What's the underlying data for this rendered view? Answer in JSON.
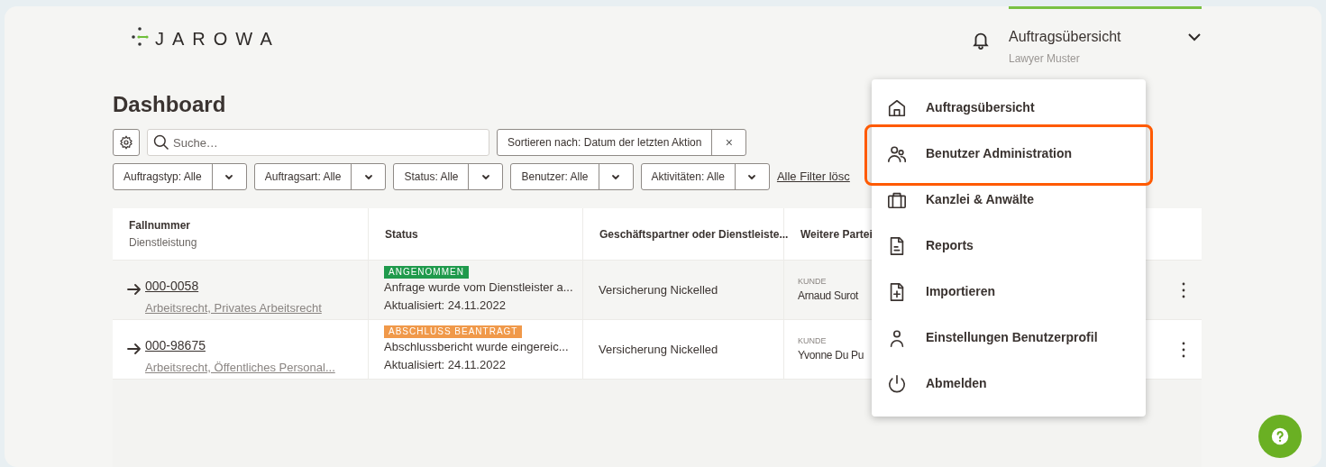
{
  "logo": {
    "text": "JAROWA"
  },
  "header": {
    "nav_label": "Auftragsübersicht",
    "user": "Lawyer Muster"
  },
  "title": "Dashboard",
  "search": {
    "placeholder": "Suche…"
  },
  "sort": {
    "label": "Sortieren nach: Datum der letzten Aktion",
    "clear": "×"
  },
  "filters": [
    {
      "label": "Auftragstyp: Alle"
    },
    {
      "label": "Auftragsart: Alle"
    },
    {
      "label": "Status: Alle"
    },
    {
      "label": "Benutzer: Alle"
    },
    {
      "label": "Aktivitäten: Alle"
    }
  ],
  "clear_filters": "Alle Filter lösc",
  "table": {
    "columns": [
      {
        "title": "Fallnummer",
        "subtitle": "Dienstleistung"
      },
      {
        "title": "Status"
      },
      {
        "title": "Geschäftspartner oder Dienstleiste..."
      },
      {
        "title": "Weitere Partei"
      }
    ],
    "rows": [
      {
        "highlighted": true,
        "case_number": "000-0058",
        "service": "Arbeitsrecht, Privates Arbeitsrecht",
        "status_badge": "ANGENOMMEN",
        "color": "#1f9a4c",
        "status_text": "Anfrage wurde vom Dienstleister a...",
        "updated": "Aktualisiert: 24.11.2022",
        "partner": "Versicherung Nickelled",
        "party_role": "KUNDE",
        "party_name": "Arnaud Surot"
      },
      {
        "highlighted": false,
        "case_number": "000-98675",
        "service": "Arbeitsrecht, Öffentliches Personal...",
        "status_badge": "ABSCHLUSS BEANTRAGT",
        "color": "#f0994a",
        "status_text": "Abschlussbericht wurde eingereic...",
        "updated": "Aktualisiert: 24.11.2022",
        "partner": "Versicherung Nickelled",
        "party_role": "KUNDE",
        "party_name": "Yvonne Du Pu"
      }
    ]
  },
  "menu": {
    "items": [
      {
        "kind": "home",
        "label": "Auftragsübersicht",
        "highlighted": false
      },
      {
        "kind": "users",
        "label": "Benutzer Administration",
        "highlighted": true
      },
      {
        "kind": "briefcase",
        "label": "Kanzlei & Anwälte",
        "highlighted": false
      },
      {
        "kind": "report",
        "label": "Reports",
        "highlighted": false
      },
      {
        "kind": "import",
        "label": "Importieren",
        "highlighted": false
      },
      {
        "kind": "profile",
        "label": "Einstellungen Benutzerprofil",
        "highlighted": false
      },
      {
        "kind": "logout",
        "label": "Abmelden",
        "highlighted": false
      }
    ]
  }
}
